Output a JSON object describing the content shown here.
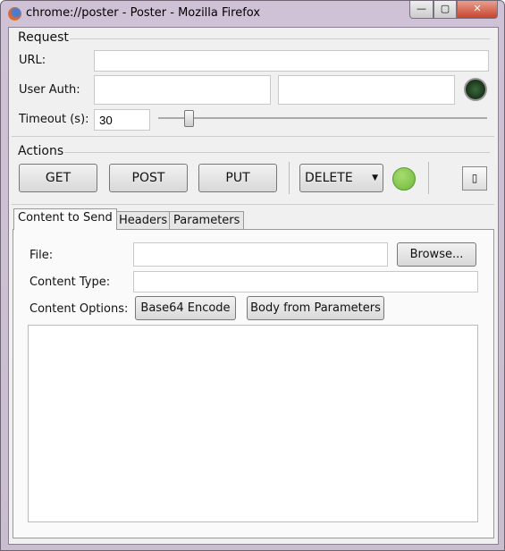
{
  "window": {
    "title": "chrome://poster - Poster - Mozilla Firefox",
    "minimize": "—",
    "maximize": "▢",
    "close": "✕"
  },
  "request": {
    "section": "Request",
    "url_label": "URL:",
    "url_value": "",
    "auth_label": "User Auth:",
    "auth_user": "",
    "auth_pass": "",
    "timeout_label": "Timeout (s):",
    "timeout_value": "30",
    "timeout_slider_fraction": 0.18
  },
  "actions": {
    "section": "Actions",
    "get": "GET",
    "post": "POST",
    "put": "PUT",
    "method_select": "DELETE",
    "status_color": "#7dc242"
  },
  "tabs": [
    {
      "label": "Content to Send",
      "active": true
    },
    {
      "label": "Headers"
    },
    {
      "label": "Parameters"
    }
  ],
  "content": {
    "file_label": "File:",
    "file_value": "",
    "browse": "Browse...",
    "type_label": "Content Type:",
    "type_value": "",
    "options_label": "Content Options:",
    "base64": "Base64 Encode",
    "body_params": "Body from Parameters",
    "body": ""
  }
}
